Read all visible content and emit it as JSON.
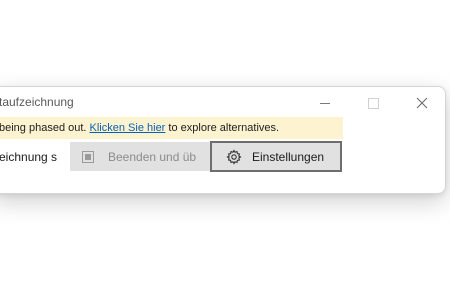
{
  "window": {
    "title": "taufzeichnung",
    "controls": {
      "minimize_icon": "minimize-icon",
      "maximize_icon": "maximize-icon",
      "close_glyph": "✕"
    }
  },
  "infobar": {
    "text_before": "being phased out. ",
    "link_text": "Klicken Sie hier",
    "text_after": " to explore alternatives.",
    "background": "#fdf3d0",
    "link_color": "#0a5fb4"
  },
  "toolbar": {
    "field_value": "eichnung s",
    "stop_button": {
      "label": "Beenden und üb",
      "icon": "stop-icon",
      "enabled": false
    },
    "settings_button": {
      "label": "Einstellungen",
      "icon": "gear-icon"
    }
  }
}
